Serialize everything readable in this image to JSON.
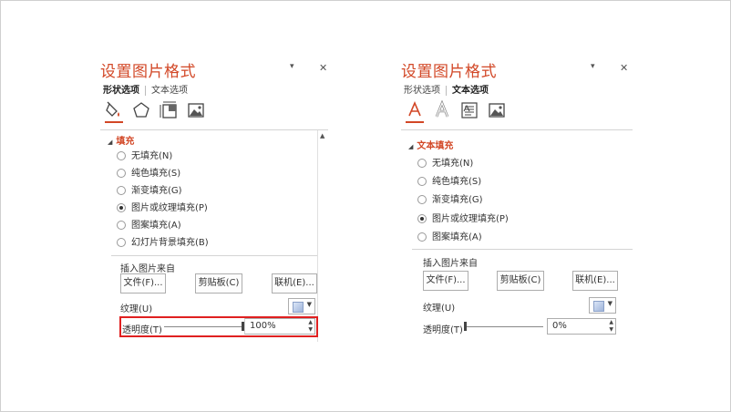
{
  "colors": {
    "accent": "#d24726",
    "highlight": "#e02020"
  },
  "left": {
    "title": "设置图片格式",
    "dropdown_icon": "chevron-down-icon",
    "close_label": "✕",
    "tabs": [
      {
        "label": "形状选项",
        "active": true
      },
      {
        "label": "文本选项",
        "active": false
      }
    ],
    "icons": [
      "fill-bucket-icon",
      "pentagon-icon",
      "size-layout-icon",
      "picture-icon"
    ],
    "section": "填充",
    "options": [
      {
        "label": "无填充(N)",
        "checked": false
      },
      {
        "label": "纯色填充(S)",
        "checked": false
      },
      {
        "label": "渐变填充(G)",
        "checked": false
      },
      {
        "label": "图片或纹理填充(P)",
        "checked": true
      },
      {
        "label": "图案填充(A)",
        "checked": false
      },
      {
        "label": "幻灯片背景填充(B)",
        "checked": false
      }
    ],
    "insert_label": "插入图片来自",
    "buttons": {
      "file": "文件(F)...",
      "clipboard": "剪贴板(C)",
      "online": "联机(E)..."
    },
    "texture_label": "纹理(U)",
    "transparency_label": "透明度(T)",
    "transparency_value": "100%",
    "transparency_level": 1.0
  },
  "right": {
    "title": "设置图片格式",
    "dropdown_icon": "chevron-down-icon",
    "close_label": "✕",
    "tabs": [
      {
        "label": "形状选项",
        "active": false
      },
      {
        "label": "文本选项",
        "active": true
      }
    ],
    "icons": [
      "text-fill-icon",
      "text-outline-icon",
      "text-box-icon",
      "picture-icon"
    ],
    "section": "文本填充",
    "options": [
      {
        "label": "无填充(N)",
        "checked": false
      },
      {
        "label": "纯色填充(S)",
        "checked": false
      },
      {
        "label": "渐变填充(G)",
        "checked": false
      },
      {
        "label": "图片或纹理填充(P)",
        "checked": true
      },
      {
        "label": "图案填充(A)",
        "checked": false
      }
    ],
    "insert_label": "插入图片来自",
    "buttons": {
      "file": "文件(F)...",
      "clipboard": "剪贴板(C)",
      "online": "联机(E)..."
    },
    "texture_label": "纹理(U)",
    "transparency_label": "透明度(T)",
    "transparency_value": "0%",
    "transparency_level": 0.0
  }
}
